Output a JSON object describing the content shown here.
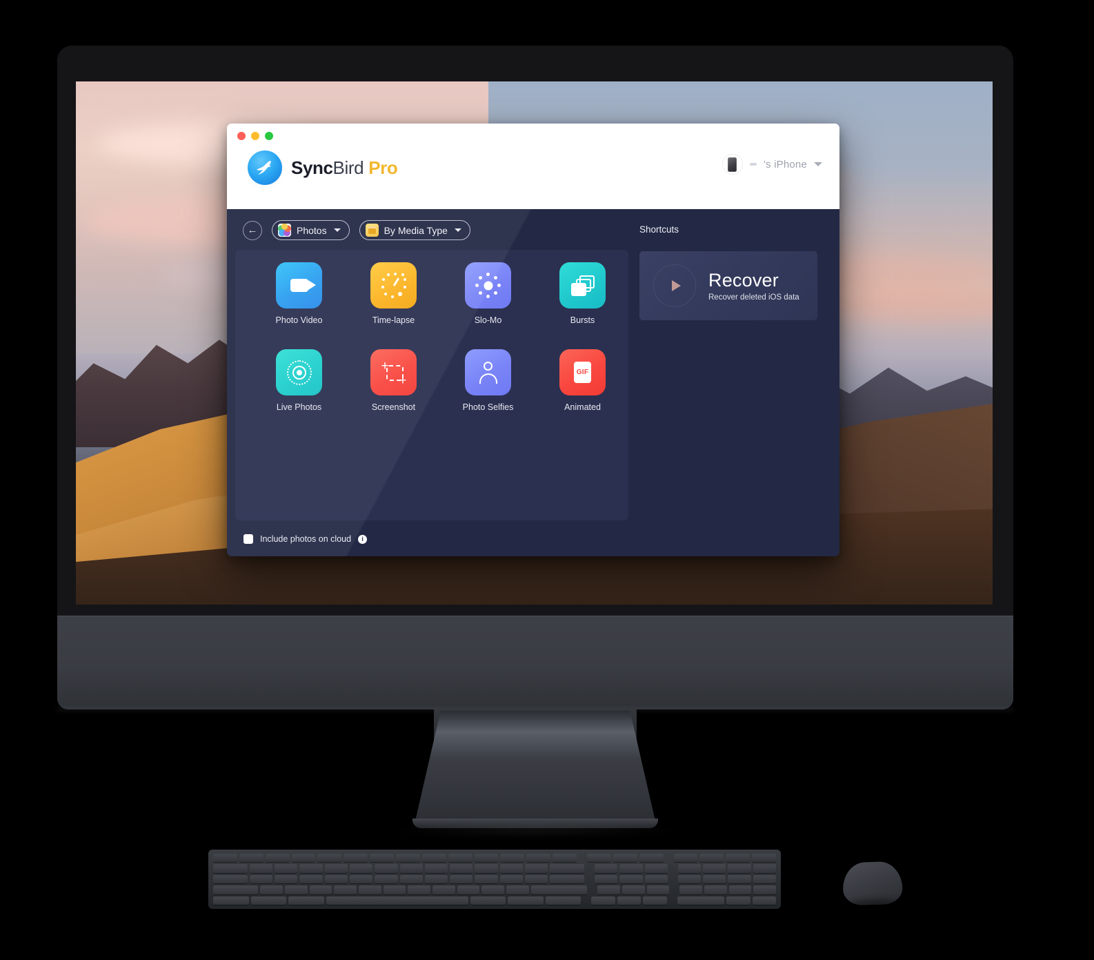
{
  "app": {
    "window_title": "SyncBird Pro",
    "brand": {
      "sync": "Sync",
      "bird": "Bird",
      "pro": "Pro",
      "logo_icon": "syncbird-bird-logo"
    },
    "traffic_lights": [
      {
        "name": "close",
        "color": "#ff5f57"
      },
      {
        "name": "minimize",
        "color": "#febc2e"
      },
      {
        "name": "zoom",
        "color": "#28c840"
      }
    ],
    "device": {
      "name": "'s iPhone",
      "thumb_icon": "iphone-thumbnail",
      "caret_icon": "chevron-down-icon"
    },
    "toolbar": {
      "back_icon": "back-arrow-icon",
      "category": {
        "label": "Photos",
        "icon": "photos-app-icon"
      },
      "grouping": {
        "label": "By Media Type",
        "icon": "media-type-icon"
      }
    },
    "media_types": [
      {
        "label": "Photo Video",
        "icon": "video-camera-icon",
        "color": "#2c9ef0"
      },
      {
        "label": "Time-lapse",
        "icon": "timelapse-dial-icon",
        "color": "#fcb423"
      },
      {
        "label": "Slo-Mo",
        "icon": "slomo-sun-icon",
        "color": "#7a84f7"
      },
      {
        "label": "Bursts",
        "icon": "burst-stack-icon",
        "color": "#21c9cd"
      },
      {
        "label": "Live Photos",
        "icon": "live-photo-icon",
        "color": "#1fcfcc"
      },
      {
        "label": "Screenshot",
        "icon": "screenshot-crop-icon",
        "color": "#f9473f"
      },
      {
        "label": "Photo Selfies",
        "icon": "person-icon",
        "color": "#7a84f7"
      },
      {
        "label": "Animated",
        "icon": "gif-card-icon",
        "color": "#f9473f",
        "badge": "GIF"
      }
    ],
    "shortcuts": {
      "heading": "Shortcuts",
      "cards": [
        {
          "title": "Recover",
          "subtitle": "Recover deleted iOS data",
          "icon": "play-circle-icon"
        }
      ]
    },
    "footer": {
      "checkbox_label": "Include photos on cloud",
      "checkbox_checked": false,
      "info_icon": "info-icon",
      "info_glyph": "i"
    }
  },
  "hardware": {
    "display": "imac-display",
    "keyboard": "magic-keyboard",
    "mouse": "magic-mouse",
    "wallpaper": "macos-mojave-desert-dusk"
  }
}
